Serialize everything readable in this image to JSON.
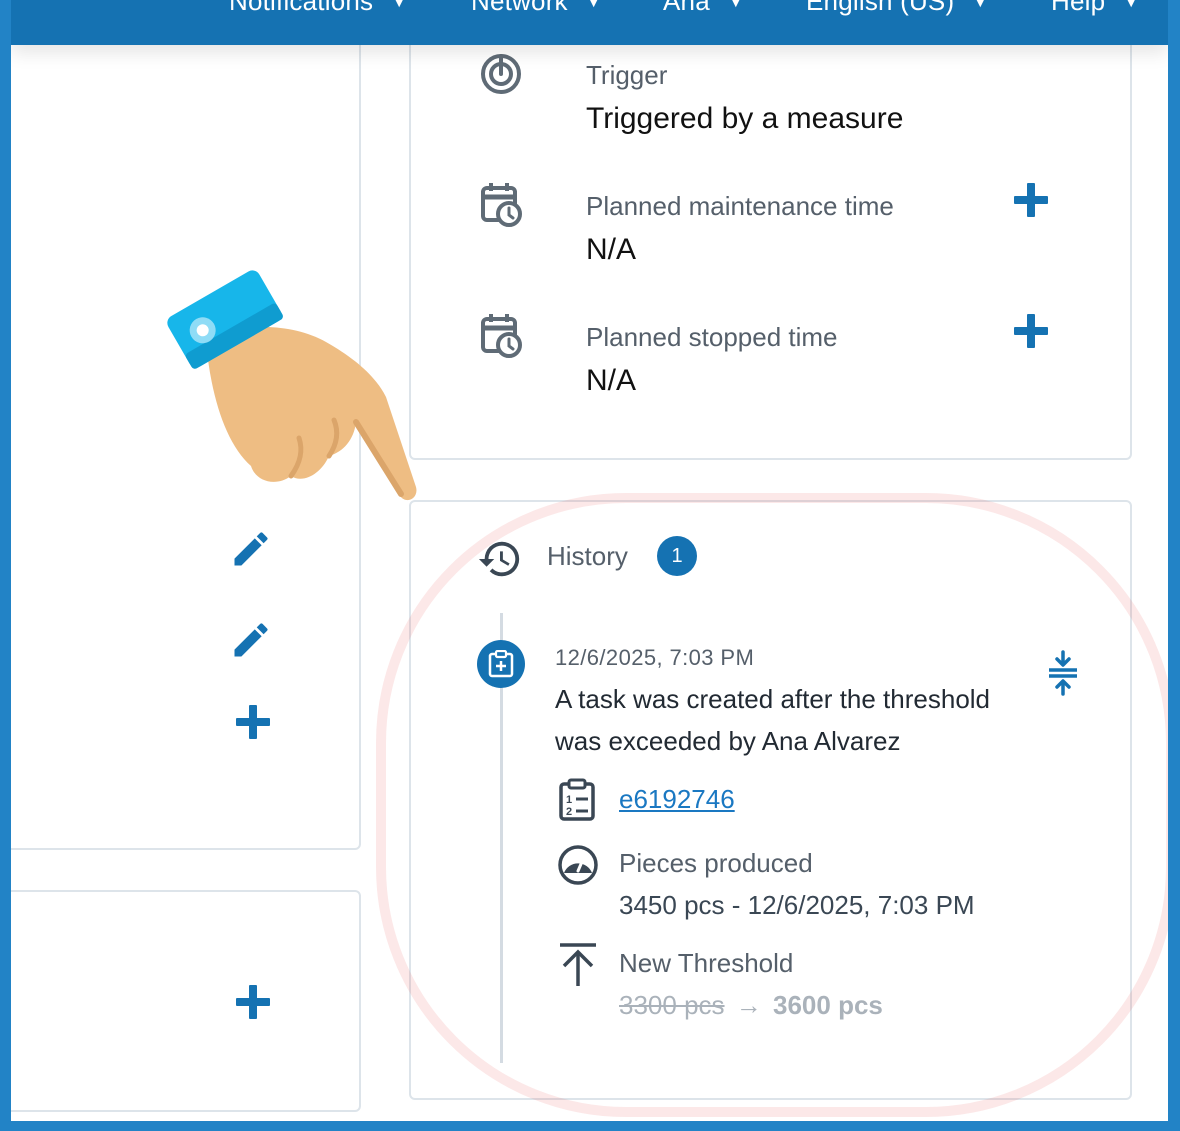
{
  "nav": {
    "items": [
      {
        "label": "Notifications"
      },
      {
        "label": "Network"
      },
      {
        "label": "Ana"
      },
      {
        "label": "English (US)"
      },
      {
        "label": "Help"
      }
    ]
  },
  "details": {
    "trigger_label": "Trigger",
    "trigger_value": "Triggered by a measure",
    "planned_maintenance_label": "Planned maintenance time",
    "planned_maintenance_value": "N/A",
    "planned_stopped_label": "Planned stopped time",
    "planned_stopped_value": "N/A"
  },
  "history": {
    "title": "History",
    "count": "1",
    "event": {
      "timestamp": "12/6/2025, 7:03 PM",
      "description_line1": "A task was created after the threshold",
      "description_line2": "was exceeded by Ana Alvarez",
      "task_link": "e6192746",
      "measure_label": "Pieces produced",
      "measure_value": "3450 pcs - 12/6/2025, 7:03 PM",
      "threshold_label": "New Threshold",
      "threshold_old": "3300 pcs",
      "threshold_arrow": "→",
      "threshold_new": "3600 pcs"
    }
  },
  "colors": {
    "primary": "#1572b2",
    "frame": "#2283c6",
    "highlight": "#f4c6c6",
    "hand_cuff": "#17b6ea",
    "hand_skin": "#eebd83"
  },
  "icons": {
    "trigger": "trigger-icon",
    "calendar_clock": "calendar-clock-icon",
    "history": "history-icon",
    "task": "task-clipboard-icon",
    "collapse": "collapse-icon",
    "checklist": "checklist-icon",
    "gauge": "gauge-icon",
    "threshold": "arrow-up-bar-icon",
    "edit": "pencil-icon",
    "add": "plus-icon",
    "pointer": "pointing-hand-icon"
  }
}
